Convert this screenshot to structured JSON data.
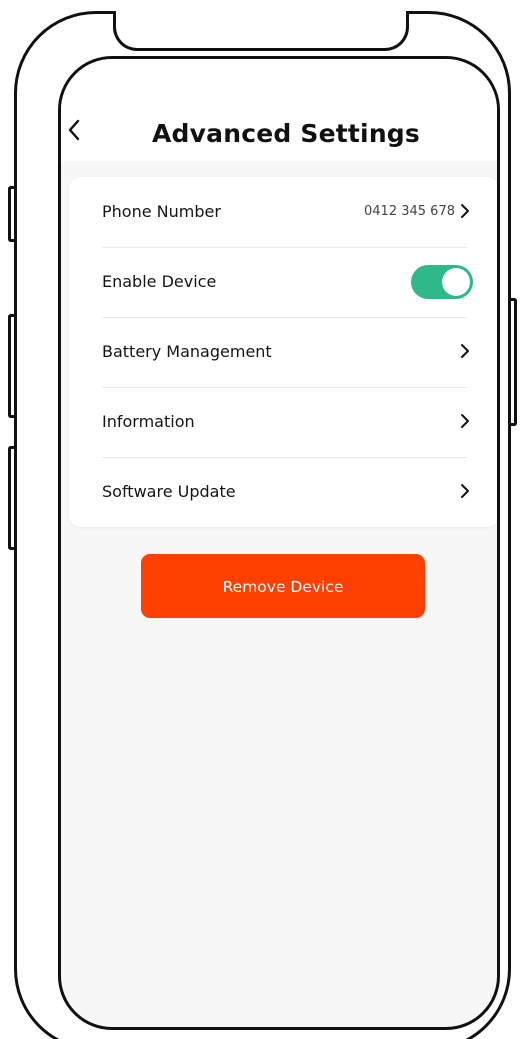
{
  "header": {
    "title": "Advanced Settings",
    "back_icon": "chevron-left-icon"
  },
  "settings": {
    "phone_number": {
      "label": "Phone Number",
      "value": "0412 345 678"
    },
    "enable_device": {
      "label": "Enable Device",
      "enabled": true
    },
    "battery_management": {
      "label": "Battery Management"
    },
    "information": {
      "label": "Information"
    },
    "software_update": {
      "label": "Software Update"
    }
  },
  "actions": {
    "remove_label": "Remove Device"
  },
  "colors": {
    "accent": "#ff4000",
    "toggle_on": "#2fb889",
    "background": "#f7f7f7"
  }
}
